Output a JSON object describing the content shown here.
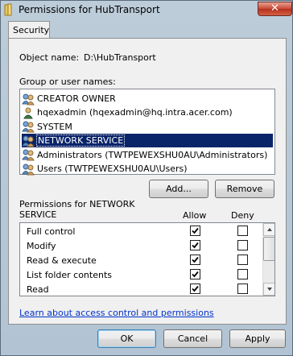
{
  "window": {
    "title": "Permissions for HubTransport",
    "close_glyph": "✕"
  },
  "tabs": [
    {
      "label": "Security"
    }
  ],
  "object": {
    "label": "Object name:",
    "value": "D:\\HubTransport"
  },
  "groups": {
    "label": "Group or user names:",
    "items": [
      {
        "name": "CREATOR OWNER",
        "icon": "user-group-icon",
        "selected": false
      },
      {
        "name": "hqexadmin (hqexadmin@hq.intra.acer.com)",
        "icon": "user-icon",
        "selected": false
      },
      {
        "name": "SYSTEM",
        "icon": "user-group-icon",
        "selected": false
      },
      {
        "name": "NETWORK SERVICE",
        "icon": "user-group-icon",
        "selected": true
      },
      {
        "name": "Administrators (TWTPEWEXSHU0AU\\Administrators)",
        "icon": "user-group-icon",
        "selected": false
      },
      {
        "name": "Users (TWTPEWEXSHU0AU\\Users)",
        "icon": "user-group-icon",
        "selected": false
      }
    ]
  },
  "buttons": {
    "add": "Add...",
    "remove": "Remove",
    "ok": "OK",
    "cancel": "Cancel",
    "apply": "Apply"
  },
  "permissions": {
    "label_line1": "Permissions for NETWORK",
    "label_line2": "SERVICE",
    "allow_header": "Allow",
    "deny_header": "Deny",
    "rows": [
      {
        "name": "Full control",
        "allow": true,
        "deny": false
      },
      {
        "name": "Modify",
        "allow": true,
        "deny": false
      },
      {
        "name": "Read & execute",
        "allow": true,
        "deny": false
      },
      {
        "name": "List folder contents",
        "allow": true,
        "deny": false
      },
      {
        "name": "Read",
        "allow": true,
        "deny": false
      }
    ]
  },
  "help_link": "Learn about access control and permissions",
  "colors": {
    "selection": "#0a246a",
    "link": "#0033cc",
    "close_button": "#c94734"
  }
}
